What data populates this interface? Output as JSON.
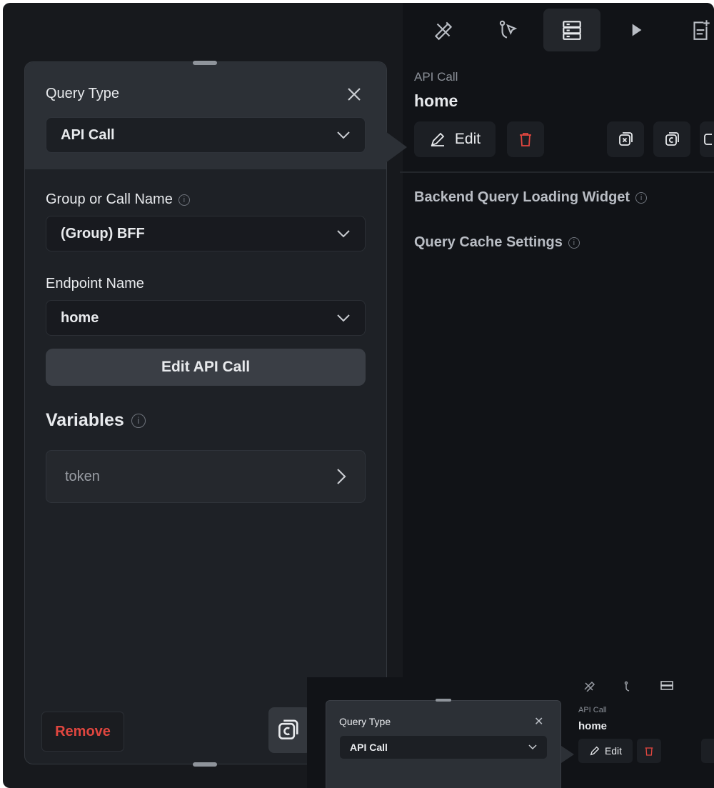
{
  "toolbar": {
    "icons": [
      "tools-icon",
      "cursor-flow-icon",
      "database-icon",
      "play-icon",
      "add-document-icon"
    ],
    "active": "database-icon"
  },
  "right_panel": {
    "subtitle": "API Call",
    "title": "home",
    "edit_label": "Edit",
    "rows": [
      {
        "label": "Backend Query Loading Widget"
      },
      {
        "label": "Query Cache Settings"
      }
    ]
  },
  "query_panel": {
    "query_type_label": "Query Type",
    "query_type_value": "API Call",
    "group_label": "Group or Call Name",
    "group_value": "(Group) BFF",
    "endpoint_label": "Endpoint Name",
    "endpoint_value": "home",
    "edit_api_label": "Edit API Call",
    "variables_label": "Variables",
    "variables": [
      {
        "name": "token"
      }
    ],
    "remove_label": "Remove"
  },
  "mini": {
    "query_type_label": "Query Type",
    "query_type_value": "API Call",
    "subtitle": "API Call",
    "title": "home",
    "edit_label": "Edit"
  },
  "colors": {
    "background": "#17191d",
    "panel": "#1e2126",
    "panel_header": "#2c3036",
    "danger": "#e0463f",
    "text": "#e8eaed"
  }
}
